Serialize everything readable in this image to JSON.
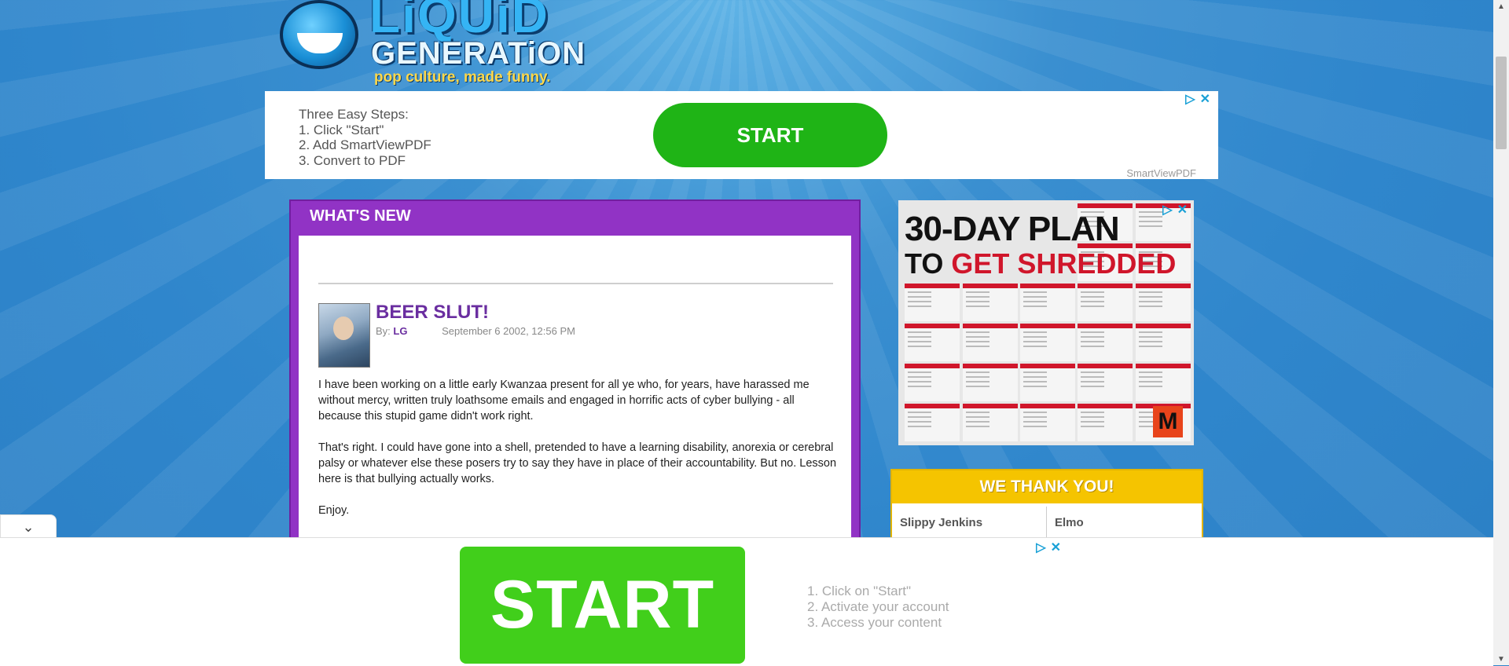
{
  "logo": {
    "line1": "LiQUiD",
    "line2": "GENERATiON",
    "tagline": "pop culture, made funny."
  },
  "top_ad": {
    "steps_title": "Three Easy Steps:",
    "step1": "1. Click \"Start\"",
    "step2": "2. Add SmartViewPDF",
    "step3": "3. Convert to PDF",
    "button_label": "START",
    "brand": "SmartViewPDF"
  },
  "whats_new": {
    "title": "WHAT'S NEW",
    "post": {
      "title": "BEER SLUT!",
      "by_label": "By:",
      "author": "LG",
      "date": "September 6 2002, 12:56 PM",
      "paragraphs": [
        "I have been working on a little early Kwanzaa present for all ye who, for years, have harassed me without mercy, written truly loathsome emails and engaged in horrific acts of cyber bullying - all because this stupid game didn't work right.",
        "That's right. I could have gone into a shell, pretended to have a learning disability, anorexia or cerebral palsy or whatever else these posers try to say they have in place of their accountability. But no. Lesson here is that bullying actually works.",
        "Enjoy."
      ]
    }
  },
  "right_ad": {
    "headline1": "30-DAY PLAN",
    "headline2_prefix": "TO ",
    "headline2_accent": "GET SHREDDED",
    "logo_letter": "M"
  },
  "thanks": {
    "title": "WE THANK YOU!",
    "names": [
      "Slippy Jenkins",
      "Elmo"
    ]
  },
  "bottom_ad": {
    "button_label": "START",
    "step1": "1. Click on \"Start\"",
    "step2": "2. Activate your account",
    "step3": "3. Access your content"
  },
  "colors": {
    "accent_purple": "#9133c5",
    "ad_green": "#1fb416",
    "thanks_yellow": "#f5c400"
  }
}
